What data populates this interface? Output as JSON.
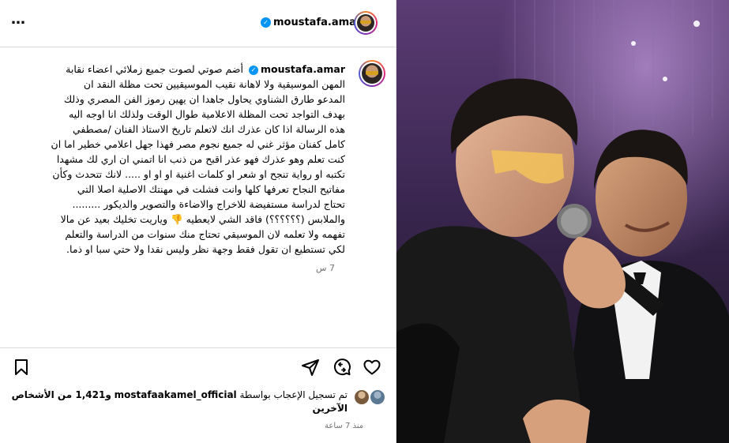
{
  "header": {
    "username": "moustafa.amar",
    "verified_mark": "✓",
    "options_label": "…"
  },
  "caption": {
    "username": "moustafa.amar",
    "text": "أضم صوتي لصوت جميع زملائي اعضاء نقابة\nالمهن الموسيقية ولا لاهانة نقيب الموسيقيين تحت مظلة النقد ان\nالمدعو طارق الشناوي يحاول جاهدا ان يهين رموز الفن المصري وذلك\nبهدف التواجد تحت المظلة الاعلامية طوال الوقت ولذلك انا اوجه اليه\nهذه الرسالة اذا كان عذرك انك لاتعلم تاريخ الاستاذ الفنان /مصطفي\nكامل كفنان مؤثر غني له جميع نجوم مصر فهذا جهل اعلامي خطير اما ان\nكنت تعلم وهو عذرك فهو عذر اقبح من ذنب انا اتمني ان اري لك مشهدا\nتكتبه او رواية تنجح او شعر او كلمات اغنية او او او ..... لانك تتحدث وكأن\nمفاتيح النجاح تعرفها كلها وانت فشلت في مهنتك الاصلية اصلا التي\nتحتاج لدراسة مستفيضة للاخراج والاضاءة والتصوير والديكور .........\nوالملابس (؟؟؟؟؟؟) فاقد الشي لايعطيه 👎 وياريت تخليك بعيد عن مالا\nتفهمه ولا تعلمه لان الموسيقي تحتاج منك سنوات من الدراسة والتعلم\nلكي تستطيع ان تقول فقط وجهة نظر وليس نقدا ولا حتي سبا او ذما.",
    "age": "7 س"
  },
  "likes": {
    "prefix": "تم تسجيل الإعجاب بواسطة",
    "account": "mostafaakamel_official",
    "suffix": "و1,421 من الأشخاص الآخرين"
  },
  "timestamp": "منذ 7 ساعة",
  "icons": [
    "bookmark-icon",
    "share-icon",
    "comment-icon",
    "heart-icon"
  ],
  "colors": {
    "verified_blue": "#0095f6",
    "border": "#dbdbdb",
    "secondary_text": "#737373"
  }
}
